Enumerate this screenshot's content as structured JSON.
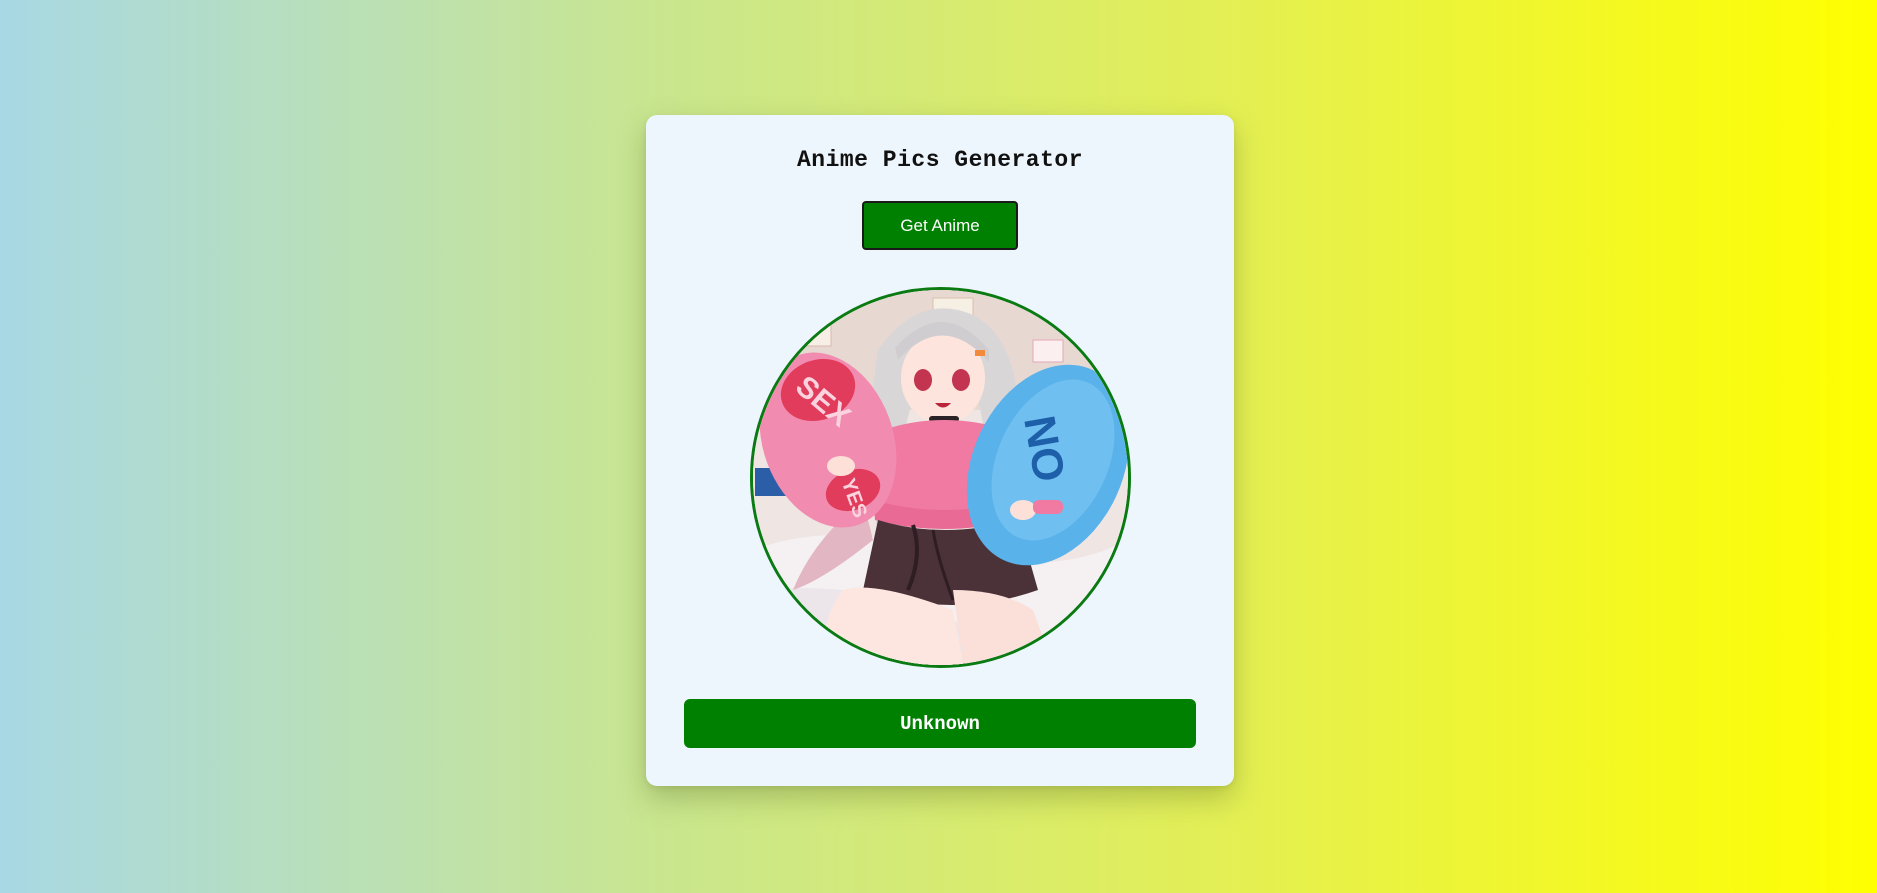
{
  "app": {
    "title": "Anime Pics Generator"
  },
  "actions": {
    "get_label": "Get Anime"
  },
  "image": {
    "alt": "anime character holding two pillows",
    "pillow_left_text": "SEX",
    "pillow_left_text2": "YES",
    "pillow_right_text": "NO"
  },
  "result": {
    "name": "Unknown"
  },
  "colors": {
    "accent": "#008000",
    "card_bg": "#eef6fd",
    "frame_border": "#0a7a12"
  }
}
